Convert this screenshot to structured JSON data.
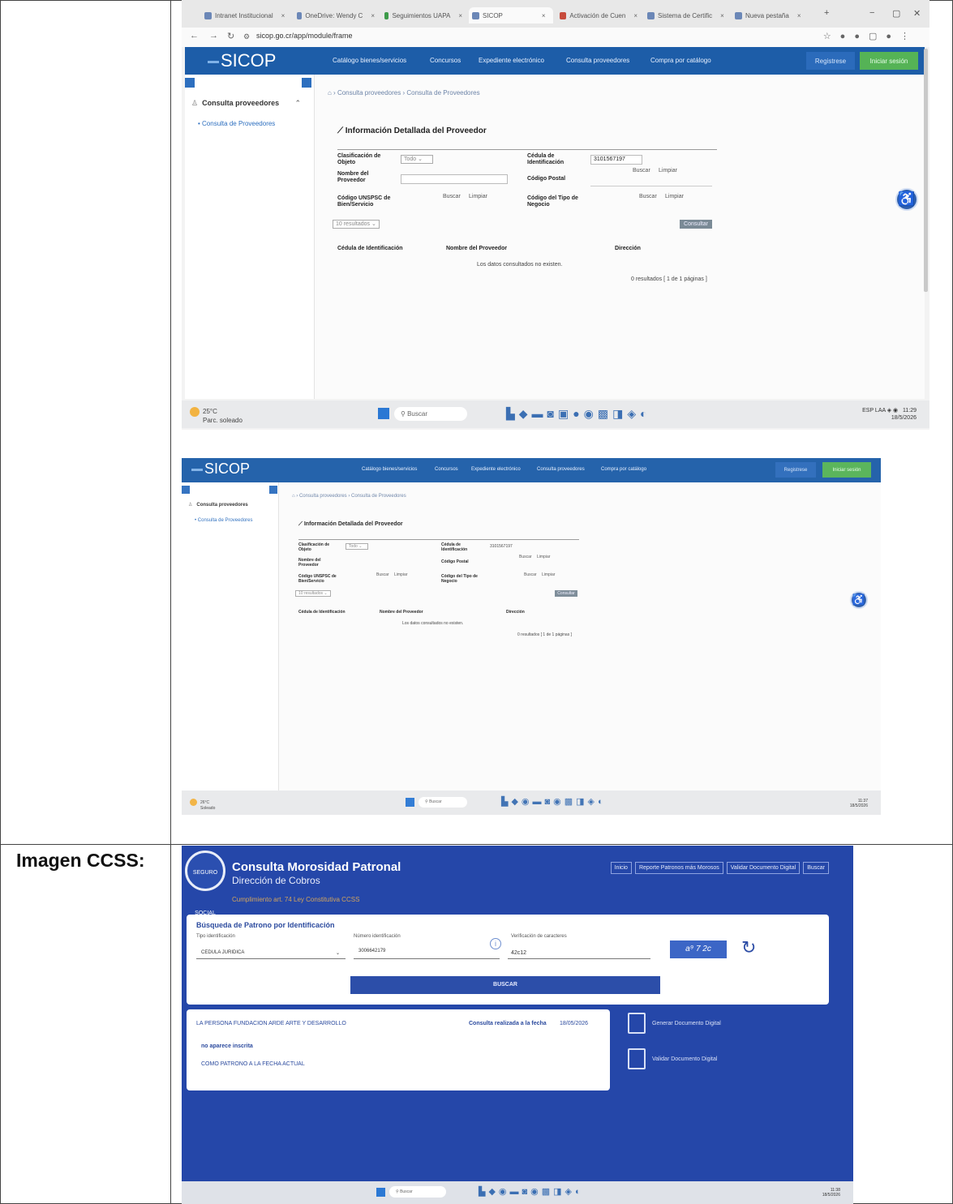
{
  "label_ccss": "Imagen CCSS:",
  "browser": {
    "tabs": [
      {
        "label": "Intranet Institucional"
      },
      {
        "label": "OneDrive: Wendy C"
      },
      {
        "label": "Seguimientos UAPA"
      },
      {
        "label": "SICOP"
      },
      {
        "label": "Activación de Cuen"
      },
      {
        "label": "Sistema de Certific"
      },
      {
        "label": "Nueva pestaña"
      }
    ],
    "url": "sicop.go.cr/app/module/frame"
  },
  "sicop": {
    "logo": "SICOP",
    "menu": [
      "Catálogo bienes/servicios",
      "Concursos",
      "Expediente electrónico",
      "Consulta proveedores",
      "Compra por catálogo"
    ],
    "register": "Registrese",
    "login": "Iniciar sesión",
    "sidebar_section": "Consulta proveedores",
    "sidebar_item": "Consulta de Proveedores",
    "breadcrumb": [
      "Consulta proveedores",
      "Consulta de Proveedores"
    ],
    "title": "Información Detallada del Proveedor",
    "form": {
      "clasificacion_label": "Clasificación de Objeto",
      "clasificacion_value": "Todo",
      "cedula_label": "Cédula de Identificación",
      "cedula_value": "3101567197",
      "nombre_label": "Nombre del Proveedor",
      "postal_label": "Código Postal",
      "unspsc_label": "Código UNSPSC de Bien/Servicio",
      "tipo_label": "Código del Tipo de Negocio",
      "buscar": "Buscar",
      "limpiar": "Limpiar",
      "page_size": "10 resultados",
      "consultar": "Consultar"
    },
    "columns": [
      "Cédula de Identificación",
      "Nombre del Proveedor",
      "Dirección"
    ],
    "no_data": "Los datos consultados no existen.",
    "pagination": "0 resultados [ 1 de 1 páginas ]"
  },
  "taskbar1": {
    "temp": "25°C",
    "weather": "Parc. soleado",
    "search": "Buscar",
    "lang": "ESP LAA",
    "time": "11:29",
    "date": "18/5/2026"
  },
  "taskbar2": {
    "temp": "26°C",
    "weather": "Soleado",
    "search": "Buscar",
    "time": "11:37",
    "date": "18/5/2026"
  },
  "taskbar3": {
    "search": "Buscar",
    "time": "11:38",
    "date": "18/5/2026"
  },
  "ccss": {
    "seal": "SEGURO SOCIAL",
    "title": "Consulta Morosidad Patronal",
    "subtitle": "Dirección de Cobros",
    "law": "Cumplimiento art. 74 Ley Constitutiva CCSS",
    "nav": [
      "Inicio",
      "Reporte Patronos más Morosos",
      "Validar Documento Digital",
      "Buscar"
    ],
    "search_title": "Búsqueda de Patrono por Identificación",
    "tipo_label": "Tipo identificación",
    "tipo_value": "CEDULA JURIDICA",
    "numero_label": "Número identificación",
    "numero_value": "3006642179",
    "verif_label": "Verificación de caracteres",
    "verif_value": "42c12",
    "captcha": "a⁹ 7 2c",
    "buscar": "BUSCAR",
    "result_name": "LA PERSONA FUNDACION ARDE ARTE Y DESARROLLO",
    "result_date_label": "Consulta realizada a la fecha",
    "result_date": "18/05/2026",
    "result_line1": "no aparece inscrita",
    "result_line2": "COMO PATRONO A LA FECHA ACTUAL",
    "generar": "Generar Documento Digital",
    "validar": "Validar Documento Digital"
  }
}
